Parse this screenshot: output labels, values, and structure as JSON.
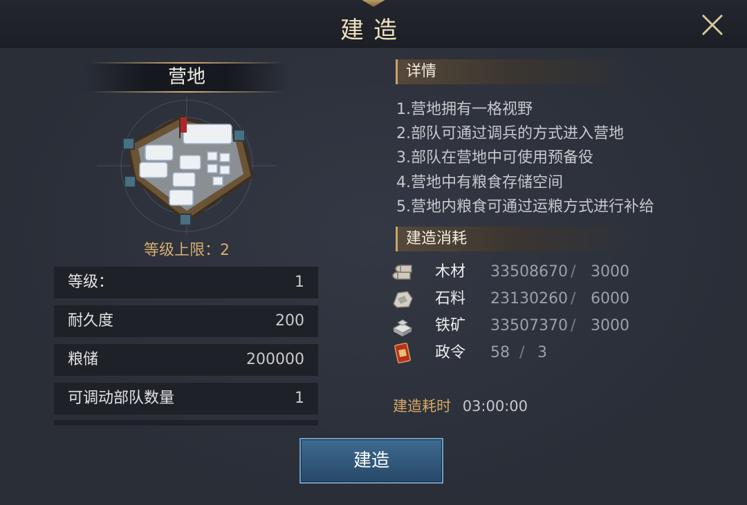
{
  "header": {
    "title": "建造"
  },
  "building": {
    "name": "营地",
    "level_limit_label": "等级上限：2"
  },
  "stats": [
    {
      "label": "等级：",
      "value": "1"
    },
    {
      "label": "耐久度",
      "value": "200"
    },
    {
      "label": "粮储",
      "value": "200000"
    },
    {
      "label": "可调动部队数量",
      "value": "1"
    }
  ],
  "details": {
    "heading": "详情",
    "lines": [
      "1.营地拥有一格视野",
      "2.部队可通过调兵的方式进入营地",
      "3.部队在营地中可使用预备役",
      "4.营地中有粮食存储空间",
      "5.营地内粮食可通过运粮方式进行补给"
    ]
  },
  "cost": {
    "heading": "建造消耗",
    "resources": [
      {
        "icon": "wood-icon",
        "name": "木材",
        "have": "33508670",
        "sep": "/",
        "need": "3000"
      },
      {
        "icon": "stone-icon",
        "name": "石料",
        "have": "23130260",
        "sep": "/",
        "need": "6000"
      },
      {
        "icon": "iron-ore-icon",
        "name": "铁矿",
        "have": "33507370",
        "sep": "/",
        "need": "3000"
      },
      {
        "icon": "decree-icon",
        "name": "政令",
        "have": "58",
        "sep": "/",
        "need": "3"
      }
    ]
  },
  "build_time": {
    "label": "建造耗时",
    "value": "03:00:00"
  },
  "build_button": {
    "label": "建造"
  },
  "colors": {
    "gold": "#d6ad6e",
    "button_blue": "#3e6a90"
  }
}
